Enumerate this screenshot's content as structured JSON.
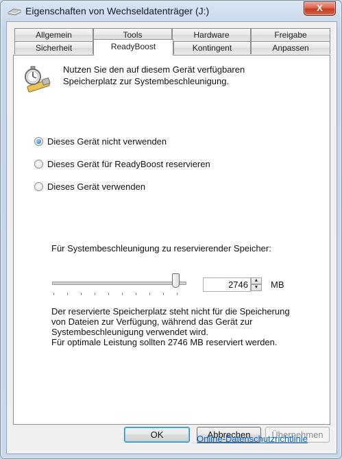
{
  "window": {
    "title": "Eigenschaften von Wechseldatenträger (J:)",
    "close_label": "X"
  },
  "tabs_row_top": [
    {
      "label": "Allgemein"
    },
    {
      "label": "Tools"
    },
    {
      "label": "Hardware"
    },
    {
      "label": "Freigabe"
    }
  ],
  "tabs_row_bottom": [
    {
      "label": "Sicherheit"
    },
    {
      "label": "ReadyBoost",
      "active": true
    },
    {
      "label": "Kontingent"
    },
    {
      "label": "Anpassen"
    }
  ],
  "readyboost": {
    "intro_line1": "Nutzen Sie den auf diesem Gerät verfügbaren",
    "intro_line2": "Speicherplatz zur Systembeschleunigung.",
    "options": [
      {
        "label": "Dieses Gerät nicht verwenden",
        "selected": true
      },
      {
        "label": "Dieses Gerät für ReadyBoost reservieren",
        "selected": false
      },
      {
        "label": "Dieses Gerät verwenden",
        "selected": false
      }
    ],
    "reserve_label": "Für Systembeschleunigung zu reservierender Speicher:",
    "slider_fraction": 0.93,
    "reserve_value": "2746",
    "unit": "MB",
    "desc_lines": [
      "Der reservierte Speicherplatz steht nicht für die Speicherung",
      "von Dateien zur Verfügung, während das Gerät zur",
      "Systembeschleunigung verwendet wird.",
      "Für optimale Leistung sollten 2746 MB reserviert werden."
    ],
    "privacy_link": "Online-Datenschutzrichtlinie"
  },
  "buttons": {
    "ok": "OK",
    "cancel": "Abbrechen",
    "apply": "Übernehmen"
  },
  "icons": {
    "title": "drive-icon",
    "intro": "readyboost-stopwatch-icon"
  }
}
